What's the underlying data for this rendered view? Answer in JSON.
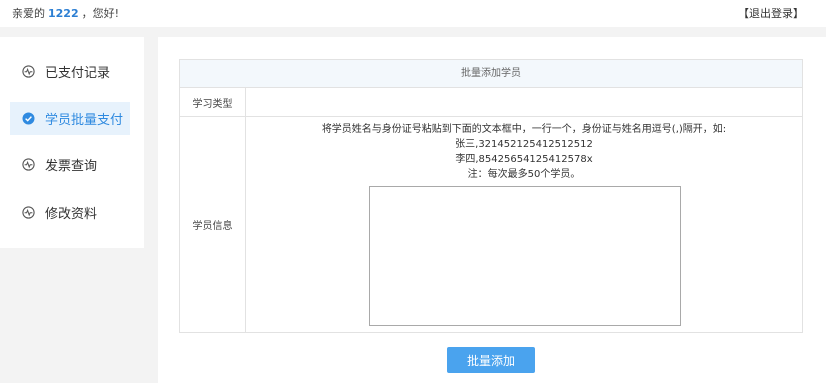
{
  "header": {
    "greeting_prefix": "亲爱的",
    "username": "1222",
    "greeting_suffix": "，您好!",
    "logout": "【退出登录】"
  },
  "sidebar": {
    "items": [
      {
        "label": "已支付记录",
        "icon": "pulse-icon",
        "active": false
      },
      {
        "label": "学员批量支付",
        "icon": "check-circle-icon",
        "active": true
      },
      {
        "label": "发票查询",
        "icon": "pulse-icon",
        "active": false
      },
      {
        "label": "修改资料",
        "icon": "pulse-icon",
        "active": false
      }
    ]
  },
  "form": {
    "section_title": "批量添加学员",
    "study_type_label": "学习类型",
    "study_type_value": "",
    "student_info_label": "学员信息",
    "instruction": "将学员姓名与身份证号粘贴到下面的文本框中，一行一个，身份证与姓名用逗号(,)隔开，如:",
    "example_1": "张三,321452125412512512",
    "example_2": "李四,85425654125412578x",
    "note": "注：每次最多50个学员。",
    "textarea_value": "",
    "submit_label": "批量添加"
  },
  "colors": {
    "accent": "#2f8ae0",
    "active_bg": "#e7f2fc",
    "button_bg": "#4aa3ee",
    "header_row_bg": "#f3f8fc",
    "page_bg": "#f3f3f3"
  }
}
